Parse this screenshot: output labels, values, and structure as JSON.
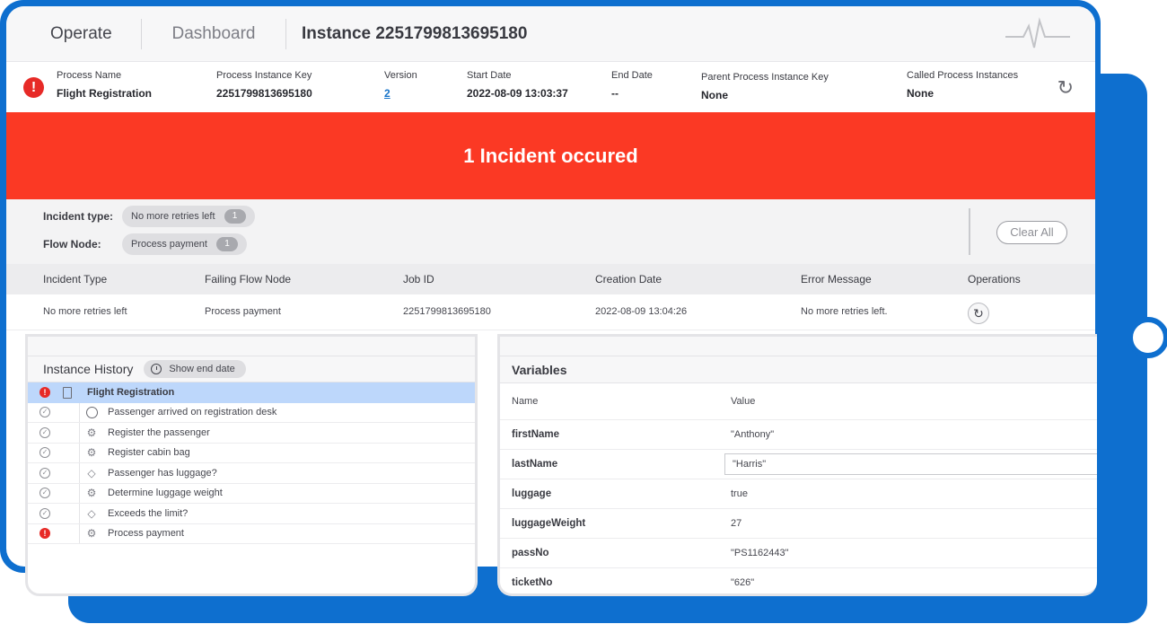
{
  "header": {
    "app_name": "Operate",
    "nav_dashboard": "Dashboard",
    "instance_title": "Instance 2251799813695180"
  },
  "summary": {
    "columns": [
      {
        "label": "Process Name",
        "value": "Flight Registration"
      },
      {
        "label": "Process Instance Key",
        "value": "2251799813695180"
      },
      {
        "label": "Version",
        "value": "2"
      },
      {
        "label": "Start Date",
        "value": "2022-08-09 13:03:37"
      },
      {
        "label": "End Date",
        "value": "--"
      },
      {
        "label": "Parent Process Instance Key",
        "value": "None"
      },
      {
        "label": "Called Process Instances",
        "value": "None"
      }
    ]
  },
  "banner": {
    "text": "1 Incident occured"
  },
  "filters": {
    "incident_type_label": "Incident type:",
    "incident_type_pill": "No more retries left",
    "incident_type_count": "1",
    "flow_node_label": "Flow Node:",
    "flow_node_pill": "Process payment",
    "flow_node_count": "1",
    "clear_all": "Clear All"
  },
  "incidents": {
    "headers": [
      "Incident Type",
      "Failing Flow Node",
      "Job ID",
      "Creation Date",
      "Error Message",
      "Operations"
    ],
    "rows": [
      [
        "No more retries left",
        "Process payment",
        "2251799813695180",
        "2022-08-09 13:04:26",
        "No more retries left."
      ]
    ]
  },
  "history": {
    "title": "Instance History",
    "show_end_date": "Show end date",
    "items": [
      {
        "label": "Flight Registration",
        "state": "error",
        "icon": "document-icon"
      },
      {
        "label": "Passenger arrived on registration desk",
        "state": "completed",
        "icon": "start-event-icon"
      },
      {
        "label": "Register the passenger",
        "state": "completed",
        "icon": "service-task-icon"
      },
      {
        "label": "Register cabin bag",
        "state": "completed",
        "icon": "service-task-icon"
      },
      {
        "label": "Passenger has luggage?",
        "state": "completed",
        "icon": "gateway-icon"
      },
      {
        "label": "Determine luggage weight",
        "state": "completed",
        "icon": "service-task-icon"
      },
      {
        "label": "Exceeds the limit?",
        "state": "completed",
        "icon": "gateway-icon"
      },
      {
        "label": "Process payment",
        "state": "error",
        "icon": "service-task-icon"
      }
    ]
  },
  "variables": {
    "title": "Variables",
    "name_header": "Name",
    "value_header": "Value",
    "rows": [
      {
        "name": "firstName",
        "value": "\"Anthony\""
      },
      {
        "name": "lastName",
        "value": "\"Harris\""
      },
      {
        "name": "luggage",
        "value": "true"
      },
      {
        "name": "luggageWeight",
        "value": "27"
      },
      {
        "name": "passNo",
        "value": "\"PS1162443\""
      },
      {
        "name": "ticketNo",
        "value": "\"626\""
      }
    ]
  }
}
